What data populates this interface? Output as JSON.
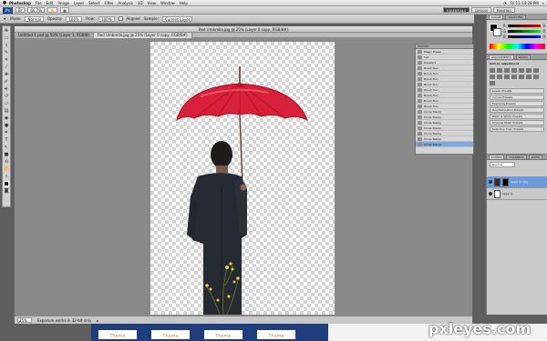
{
  "menubar": {
    "app": "Photoshop",
    "items": [
      "File",
      "Edit",
      "Image",
      "Layer",
      "Select",
      "Filter",
      "Analysis",
      "3D",
      "View",
      "Window",
      "Help"
    ],
    "time": "Fri 11:14:28 PM"
  },
  "appbar": {
    "logo": "Ps",
    "zoom": "66.7%",
    "workspaces": [
      "ESSENTIALS",
      "DESIGN",
      "PAINTING"
    ],
    "active_workspace": "ESSENTIALS"
  },
  "options": {
    "mode_label": "Mode:",
    "mode_value": "Normal",
    "opacity_label": "Opacity:",
    "opacity_value": "100%",
    "flow_label": "Flow:",
    "flow_value": "100%",
    "aligned_label": "Aligned",
    "sample_label": "Sample:",
    "sample_value": "Current Layer"
  },
  "document": {
    "title": "Red Umbrella.jpg @ 25% (Layer 0 copy, RGB/8#)",
    "tabs": [
      {
        "label": "Untitled-1.psd @ 50% (Layer 1, RGB/8)"
      },
      {
        "label": "Red Umbrella.jpg @ 25% (Layer 0 copy, RGB/8#)"
      }
    ],
    "status_zoom": "25%",
    "status_text": "Exposure works in 32-bit only"
  },
  "history": {
    "tab": "HISTORY",
    "items": [
      {
        "label": "Magic Eraser"
      },
      {
        "label": "Cut"
      },
      {
        "label": "Deselect"
      },
      {
        "label": "Brush Tool"
      },
      {
        "label": "Brush Tool"
      },
      {
        "label": "Brush Tool"
      },
      {
        "label": "Brush Tool"
      },
      {
        "label": "Brush Tool"
      },
      {
        "label": "Brush Tool"
      },
      {
        "label": "Brush Tool"
      },
      {
        "label": "Brush Tool"
      },
      {
        "label": "Clone Stamp"
      },
      {
        "label": "Clone Stamp"
      },
      {
        "label": "Clone Stamp"
      },
      {
        "label": "Clone Stamp"
      },
      {
        "label": "Clone Stamp"
      },
      {
        "label": "Clone Stamp"
      },
      {
        "label": "Clone Stamp"
      }
    ],
    "selected_index": 17
  },
  "color_panel": {
    "tabs": [
      "COLOR",
      "SWATCHES"
    ],
    "channels": [
      {
        "name": "R",
        "value": "0"
      },
      {
        "name": "G",
        "value": "0"
      },
      {
        "name": "B",
        "value": "0"
      }
    ]
  },
  "adjustments_panel": {
    "tabs": [
      "ADJUSTMENTS",
      "MASKS"
    ],
    "heading": "Add an adjustment",
    "presets": [
      {
        "label": "Levels Presets"
      },
      {
        "label": "Curves Presets"
      },
      {
        "label": "Exposure Presets"
      },
      {
        "label": "Hue/Saturation Presets"
      },
      {
        "label": "Black & White Presets"
      },
      {
        "label": "Channel Mixer Presets"
      },
      {
        "label": "Selective Color Presets"
      }
    ]
  },
  "layers_panel": {
    "tabs": [
      "LAYERS",
      "CHANNELS",
      "PATHS"
    ],
    "blend_mode": "Normal",
    "layers": [
      {
        "name": "Layer 0 copy",
        "selected": true
      },
      {
        "name": "Layer 0",
        "selected": false
      }
    ]
  },
  "background_page": {
    "cards": [
      "Theme",
      "Theme",
      "Theme",
      "Theme"
    ]
  },
  "watermark": "pxleyes.com",
  "colors": {
    "umbrella": "#d9203a",
    "suit": "#262a33",
    "selection": "#7aa9e0",
    "accent_blue": "#1f3d7a"
  }
}
